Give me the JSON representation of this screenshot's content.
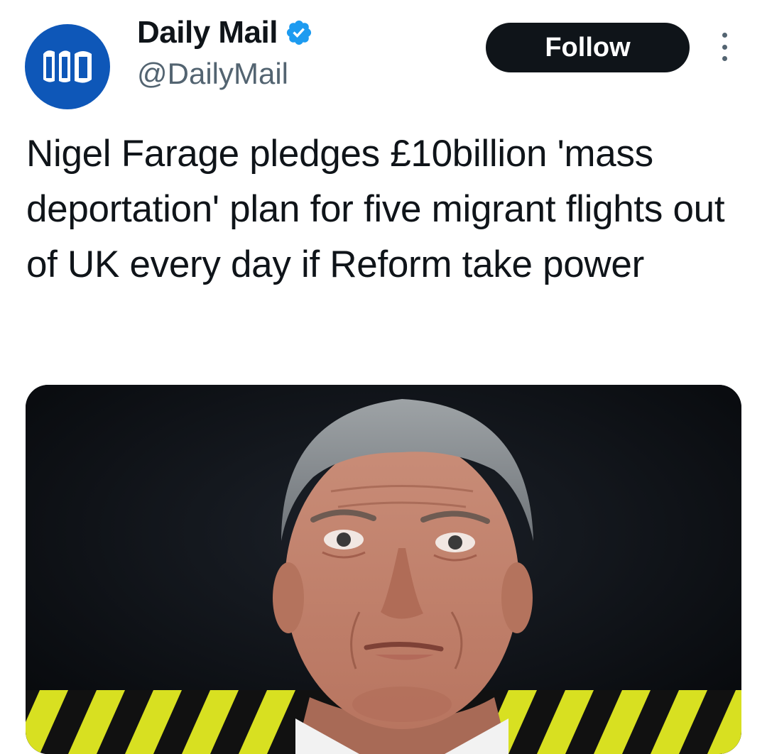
{
  "account": {
    "name": "Daily Mail",
    "handle": "@DailyMail",
    "avatar_icon": "daily-mail-logo-icon",
    "verified_icon": "verified-badge-icon",
    "avatar_color": "#0e57b8",
    "verified_color": "#1d9bf0"
  },
  "actions": {
    "follow_label": "Follow",
    "more_icon": "more-vertical-icon"
  },
  "tweet": {
    "text": "Nigel Farage pledges £10billion 'mass deportation' plan for five migrant flights out of UK every day if Reform take power"
  },
  "media": {
    "type": "photo",
    "description_icon": "news-photo"
  }
}
